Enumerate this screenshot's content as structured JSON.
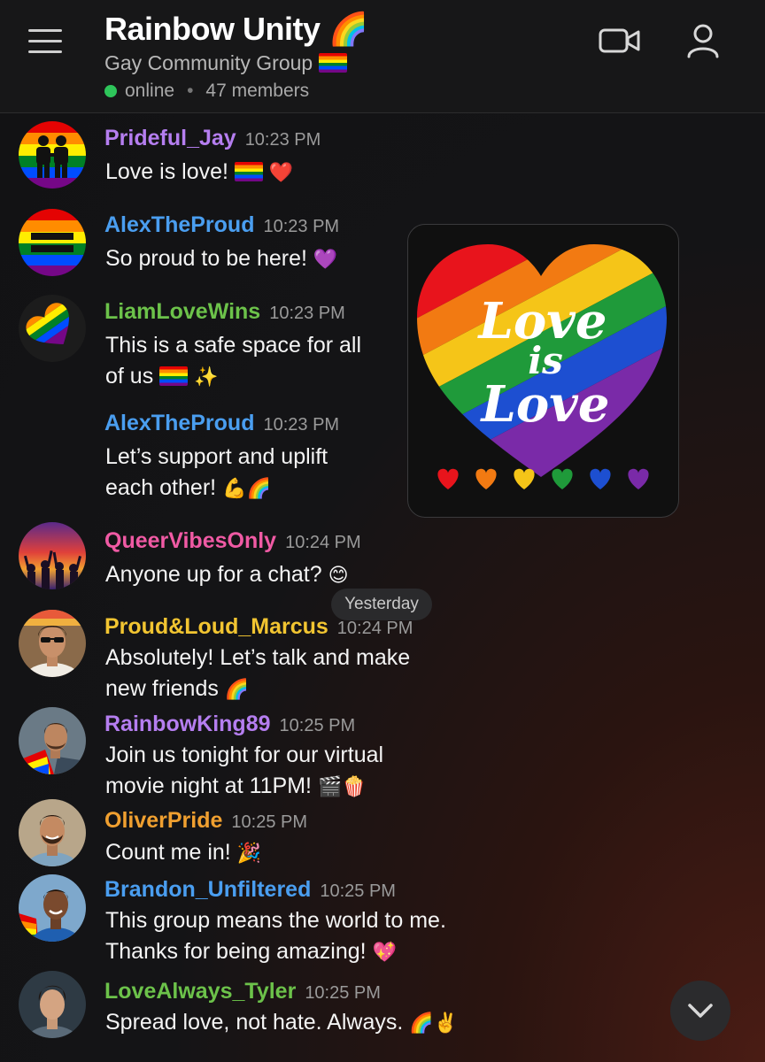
{
  "header": {
    "title": "Rainbow Unity 🌈",
    "subtitle": "Gay Community Group",
    "status": "online",
    "members": "47 members"
  },
  "messages": [
    {
      "user": "Prideful_Jay",
      "time": "10:23 PM",
      "color": "#b57ef0",
      "line1": "Love is love!",
      "emoji": "❤️"
    },
    {
      "user": "AlexTheProud",
      "time": "10:23 PM",
      "color": "#4a9ef0",
      "line1": "So proud to be here!",
      "emoji": "💜"
    },
    {
      "user": "LiamLoveWins",
      "time": "10:23 PM",
      "color": "#6cc24a",
      "line1": "This is a safe space for all",
      "line2": "of us",
      "emoji": "✨"
    },
    {
      "user": "AlexTheProud",
      "time": "10:23 PM",
      "color": "#4a9ef0",
      "line1": "Let’s support and uplift",
      "line2": "each other!",
      "emoji": "💪🌈"
    },
    {
      "user": "QueerVibesOnly",
      "time": "10:24 PM",
      "color": "#f05aa4",
      "line1": "Anyone up for a chat?",
      "emoji": "😊"
    },
    {
      "user": "Proud&Loud_Marcus",
      "time": "10:24 PM",
      "color": "#f2c531",
      "line1": "Absolutely! Let’s talk and make",
      "line2": "new friends",
      "emoji": "🌈"
    },
    {
      "user": "RainbowKing89",
      "time": "10:25 PM",
      "color": "#b57ef0",
      "line1": "Join us tonight for our virtual",
      "line2": "movie night at 11PM!",
      "emoji": "🎬🍿"
    },
    {
      "user": "OliverPride",
      "time": "10:25 PM",
      "color": "#f0a030",
      "line1": "Count me in!",
      "emoji": "🎉"
    },
    {
      "user": "Brandon_Unfiltered",
      "time": "10:25 PM",
      "color": "#4a9ef0",
      "line1": "This group means the world to me.",
      "line2": "Thanks for being amazing!",
      "emoji": "💖"
    },
    {
      "user": "LoveAlways_Tyler",
      "time": "10:25 PM",
      "color": "#6cc24a",
      "line1": "Spread love, not hate. Always.",
      "emoji": "🌈✌️"
    }
  ],
  "image": {
    "line1": "Love",
    "line2": "is",
    "line3": "Love",
    "hearts": [
      "#e8141c",
      "#f27a12",
      "#f5c518",
      "#1f9a3a",
      "#1d4fd1",
      "#7a2aa8"
    ]
  },
  "day_label": "Yesterday",
  "icons": {
    "menu": "hamburger-menu-icon",
    "video": "video-camera-icon",
    "profile": "person-icon",
    "scroll": "chevron-down-icon"
  }
}
